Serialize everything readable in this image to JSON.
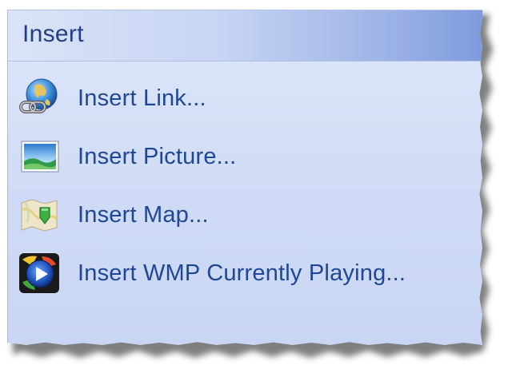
{
  "panel": {
    "title": "Insert",
    "items": [
      {
        "label": "Insert Link...",
        "icon": "link-globe-icon"
      },
      {
        "label": "Insert Picture...",
        "icon": "picture-icon"
      },
      {
        "label": "Insert Map...",
        "icon": "map-pin-icon"
      },
      {
        "label": "Insert WMP Currently Playing...",
        "icon": "windows-media-player-icon"
      }
    ]
  },
  "colors": {
    "title_text": "#1f3f87",
    "item_text": "#1f4797",
    "panel_background": "#d2ddf6",
    "header_gradient_end": "#7f9bdc"
  }
}
